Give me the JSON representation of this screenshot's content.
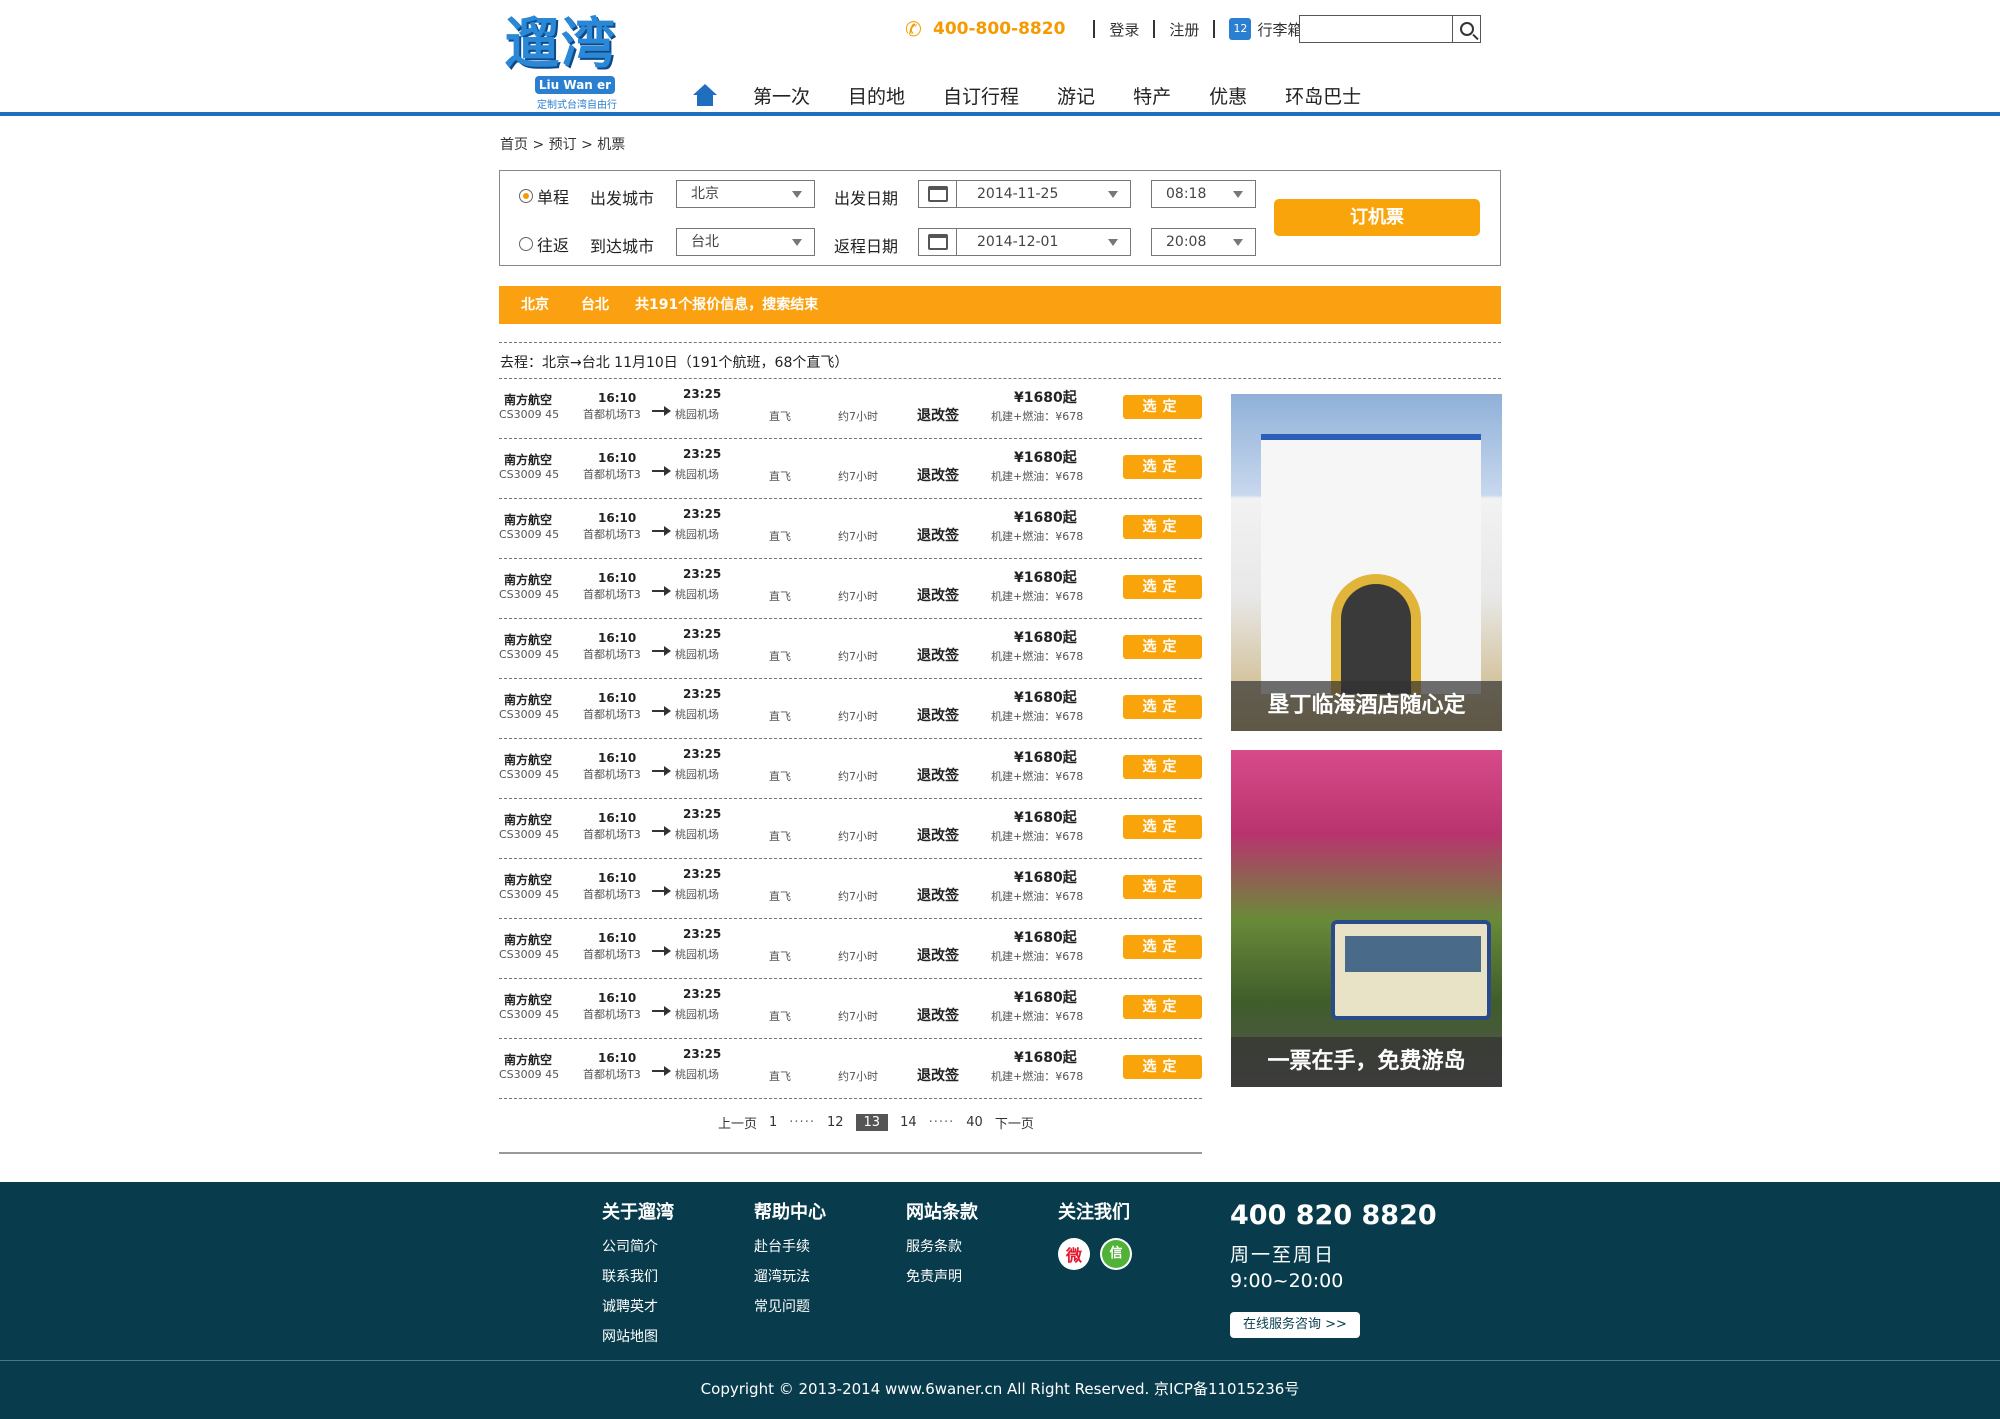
{
  "header": {
    "logo_cn": "遛湾",
    "logo_en": "Liu Wan er",
    "logo_sub": "定制式台湾自由行",
    "phone": "400-800-8820",
    "login": "登录",
    "register": "注册",
    "bag_count": "12",
    "bag_label": "行李箱",
    "search_placeholder": ""
  },
  "nav": [
    "第一次",
    "目的地",
    "自订行程",
    "游记",
    "特产",
    "优惠",
    "环岛巴士"
  ],
  "breadcrumb": "首页 > 预订 > 机票",
  "search_panel": {
    "oneway": "单程",
    "roundtrip": "往返",
    "depart_city_label": "出发城市",
    "arrive_city_label": "到达城市",
    "depart_city": "北京",
    "arrive_city": "台北",
    "depart_date_label": "出发日期",
    "return_date_label": "返程日期",
    "depart_date": "2014-11-25",
    "return_date": "2014-12-01",
    "depart_time": "08:18",
    "return_time": "20:08",
    "book_button": "订机票"
  },
  "result_bar": {
    "from": "北京",
    "to": "台北",
    "summary": "共191个报价信息，搜索结束"
  },
  "route_line": "去程：北京→台北   11月10日（191个航班，68个直飞）",
  "flights": [
    {
      "airline": "南方航空",
      "flight_no": "CS3009 45",
      "dep_time": "16:10",
      "arr_time": "23:25",
      "dep_airport": "首都机场T3",
      "arr_airport": "桃园机场",
      "type": "直飞",
      "duration": "约7小时",
      "refund": "退改签",
      "price": "¥1680起",
      "tax": "机建+燃油：¥678",
      "button": "选定"
    },
    {
      "airline": "南方航空",
      "flight_no": "CS3009 45",
      "dep_time": "16:10",
      "arr_time": "23:25",
      "dep_airport": "首都机场T3",
      "arr_airport": "桃园机场",
      "type": "直飞",
      "duration": "约7小时",
      "refund": "退改签",
      "price": "¥1680起",
      "tax": "机建+燃油：¥678",
      "button": "选定"
    },
    {
      "airline": "南方航空",
      "flight_no": "CS3009 45",
      "dep_time": "16:10",
      "arr_time": "23:25",
      "dep_airport": "首都机场T3",
      "arr_airport": "桃园机场",
      "type": "直飞",
      "duration": "约7小时",
      "refund": "退改签",
      "price": "¥1680起",
      "tax": "机建+燃油：¥678",
      "button": "选定"
    },
    {
      "airline": "南方航空",
      "flight_no": "CS3009 45",
      "dep_time": "16:10",
      "arr_time": "23:25",
      "dep_airport": "首都机场T3",
      "arr_airport": "桃园机场",
      "type": "直飞",
      "duration": "约7小时",
      "refund": "退改签",
      "price": "¥1680起",
      "tax": "机建+燃油：¥678",
      "button": "选定"
    },
    {
      "airline": "南方航空",
      "flight_no": "CS3009 45",
      "dep_time": "16:10",
      "arr_time": "23:25",
      "dep_airport": "首都机场T3",
      "arr_airport": "桃园机场",
      "type": "直飞",
      "duration": "约7小时",
      "refund": "退改签",
      "price": "¥1680起",
      "tax": "机建+燃油：¥678",
      "button": "选定"
    },
    {
      "airline": "南方航空",
      "flight_no": "CS3009 45",
      "dep_time": "16:10",
      "arr_time": "23:25",
      "dep_airport": "首都机场T3",
      "arr_airport": "桃园机场",
      "type": "直飞",
      "duration": "约7小时",
      "refund": "退改签",
      "price": "¥1680起",
      "tax": "机建+燃油：¥678",
      "button": "选定"
    },
    {
      "airline": "南方航空",
      "flight_no": "CS3009 45",
      "dep_time": "16:10",
      "arr_time": "23:25",
      "dep_airport": "首都机场T3",
      "arr_airport": "桃园机场",
      "type": "直飞",
      "duration": "约7小时",
      "refund": "退改签",
      "price": "¥1680起",
      "tax": "机建+燃油：¥678",
      "button": "选定"
    },
    {
      "airline": "南方航空",
      "flight_no": "CS3009 45",
      "dep_time": "16:10",
      "arr_time": "23:25",
      "dep_airport": "首都机场T3",
      "arr_airport": "桃园机场",
      "type": "直飞",
      "duration": "约7小时",
      "refund": "退改签",
      "price": "¥1680起",
      "tax": "机建+燃油：¥678",
      "button": "选定"
    },
    {
      "airline": "南方航空",
      "flight_no": "CS3009 45",
      "dep_time": "16:10",
      "arr_time": "23:25",
      "dep_airport": "首都机场T3",
      "arr_airport": "桃园机场",
      "type": "直飞",
      "duration": "约7小时",
      "refund": "退改签",
      "price": "¥1680起",
      "tax": "机建+燃油：¥678",
      "button": "选定"
    },
    {
      "airline": "南方航空",
      "flight_no": "CS3009 45",
      "dep_time": "16:10",
      "arr_time": "23:25",
      "dep_airport": "首都机场T3",
      "arr_airport": "桃园机场",
      "type": "直飞",
      "duration": "约7小时",
      "refund": "退改签",
      "price": "¥1680起",
      "tax": "机建+燃油：¥678",
      "button": "选定"
    },
    {
      "airline": "南方航空",
      "flight_no": "CS3009 45",
      "dep_time": "16:10",
      "arr_time": "23:25",
      "dep_airport": "首都机场T3",
      "arr_airport": "桃园机场",
      "type": "直飞",
      "duration": "约7小时",
      "refund": "退改签",
      "price": "¥1680起",
      "tax": "机建+燃油：¥678",
      "button": "选定"
    },
    {
      "airline": "南方航空",
      "flight_no": "CS3009 45",
      "dep_time": "16:10",
      "arr_time": "23:25",
      "dep_airport": "首都机场T3",
      "arr_airport": "桃园机场",
      "type": "直飞",
      "duration": "约7小时",
      "refund": "退改签",
      "price": "¥1680起",
      "tax": "机建+燃油：¥678",
      "button": "选定"
    }
  ],
  "pagination": {
    "prev": "上一页",
    "p1": "1",
    "dots": "·····",
    "p12": "12",
    "current": "13",
    "p14": "14",
    "p40": "40",
    "next": "下一页"
  },
  "ads": [
    {
      "caption": "垦丁临海酒店随心定"
    },
    {
      "caption": "一票在手，免费游岛"
    }
  ],
  "footer": {
    "col1": {
      "head": "关于遛湾",
      "links": [
        "公司简介",
        "联系我们",
        "诚聘英才",
        "网站地图"
      ]
    },
    "col2": {
      "head": "帮助中心",
      "links": [
        "赴台手续",
        "遛湾玩法",
        "常见问题"
      ]
    },
    "col3": {
      "head": "网站条款",
      "links": [
        "服务条款",
        "免责声明"
      ]
    },
    "col4": {
      "head": "关注我们"
    },
    "phone": "400 820 8820",
    "days": "周一至周日",
    "hours": "9:00~20:00",
    "service": "在线服务咨询 >>",
    "copyright": "Copyright © 2013-2014 www.6waner.cn All Right Reserved. 京ICP备11015236号"
  },
  "colors": {
    "brand_blue": "#1f6fbe",
    "accent_orange": "#f9a40a",
    "footer_bg": "#083c4d"
  }
}
